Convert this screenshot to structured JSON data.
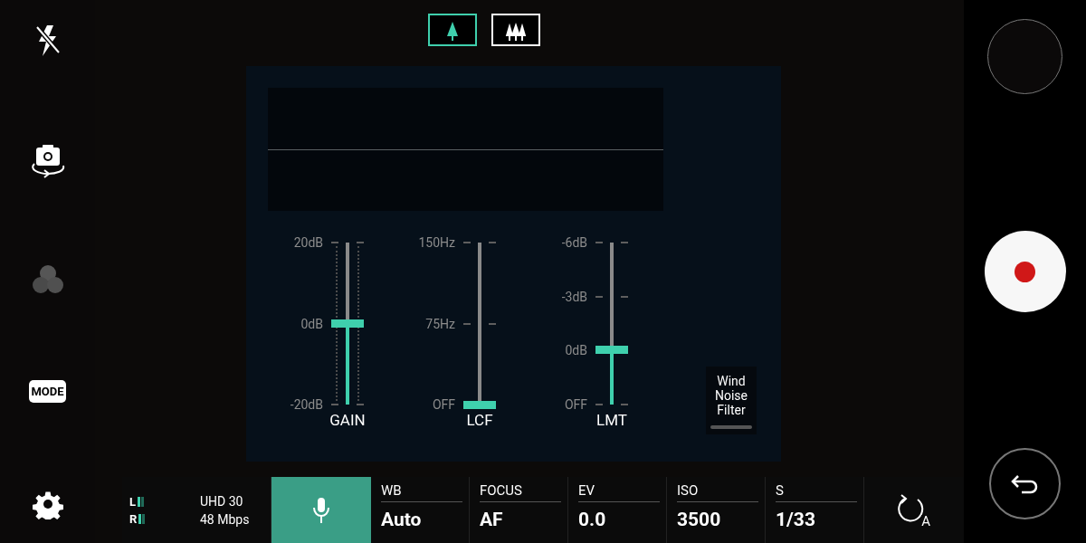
{
  "sidebar": {
    "mode_button": "MODE"
  },
  "wind_modes": [
    {
      "kind": "single",
      "selected": true
    },
    {
      "kind": "multi",
      "selected": false
    }
  ],
  "sliders": [
    {
      "label": "GAIN",
      "level": 0.5,
      "minor_ticks": true,
      "ticks": [
        "20dB",
        "0dB",
        "-20dB"
      ]
    },
    {
      "label": "LCF",
      "level": 0,
      "minor_ticks": false,
      "ticks": [
        "150Hz",
        "75Hz",
        "OFF"
      ]
    },
    {
      "label": "LMT",
      "level": 0.34,
      "minor_ticks": false,
      "ticks": [
        "-6dB",
        "-3dB",
        "0dB",
        "OFF"
      ]
    }
  ],
  "wind_noise_filter": {
    "label": "Wind Noise Filter",
    "on": false
  },
  "status_bar": {
    "channels": [
      {
        "label": "L"
      },
      {
        "label": "R"
      }
    ],
    "resolution": "UHD 30",
    "bitrate": "48 Mbps",
    "mic": {
      "selected": true
    },
    "settings": [
      {
        "label": "WB",
        "value": "Auto"
      },
      {
        "label": "FOCUS",
        "value": "AF"
      },
      {
        "label": "EV",
        "value": "0.0"
      },
      {
        "label": "ISO",
        "value": "3500"
      },
      {
        "label": "S",
        "value": "1/33"
      }
    ],
    "auto_rotate": "A"
  }
}
